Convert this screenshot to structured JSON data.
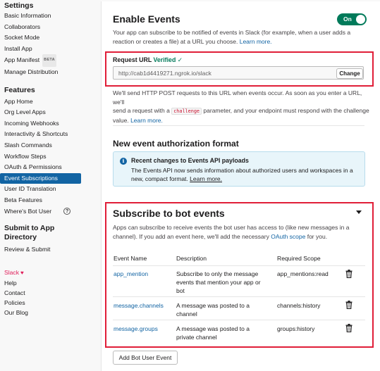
{
  "sidebar": {
    "settings_heading": "Settings",
    "settings_items": [
      "Basic Information",
      "Collaborators",
      "Socket Mode",
      "Install App"
    ],
    "app_manifest": "App Manifest",
    "beta_badge": "BETA",
    "manage_distribution": "Manage Distribution",
    "features_heading": "Features",
    "feature_items": [
      "App Home",
      "Org Level Apps",
      "Incoming Webhooks",
      "Interactivity & Shortcuts",
      "Slash Commands",
      "Workflow Steps",
      "OAuth & Permissions"
    ],
    "active_item": "Event Subscriptions",
    "feature_items_after": [
      "User ID Translation",
      "Beta Features"
    ],
    "wheres_bot_user": "Where's Bot User",
    "help_glyph": "?",
    "submit_heading_1": "Submit to App",
    "submit_heading_2": "Directory",
    "review_submit": "Review & Submit",
    "footer_slack": "Slack",
    "footer_links": [
      "Help",
      "Contact",
      "Policies",
      "Our Blog"
    ]
  },
  "enable_events": {
    "title": "Enable Events",
    "toggle_label": "On",
    "desc_line1": "Your app can subscribe to be notified of events in Slack (for example, when a user adds a",
    "desc_line2": "reaction or creates a file) at a URL you choose.",
    "learn_more": "Learn more.",
    "request_url_label": "Request URL",
    "verified": "Verified",
    "check": "✓",
    "url_value": "http://cab1d4419271.ngrok.io/slack",
    "change_button": "Change",
    "post_line1": "We'll send HTTP POST requests to this URL when events occur. As soon as you enter a URL, we'll",
    "post_line2a": "send a request with a",
    "challenge_code": "challenge",
    "post_line2b": "parameter, and your endpoint must respond with the challenge",
    "post_line3": "value.",
    "post_learn_more": "Learn more."
  },
  "auth_format": {
    "title": "New event authorization format",
    "info_title": "Recent changes to Events API payloads",
    "info_line1": "The Events API now sends information about authorized users and workspaces in a",
    "info_line2": "new, compact format.",
    "info_learn_more": "Learn more."
  },
  "bot_events": {
    "title": "Subscribe to bot events",
    "desc_line1": "Apps can subscribe to receive events the bot user has access to (like new messages in a",
    "desc_line2a": "channel). If you add an event here, we'll add the necessary",
    "oauth_scope": "OAuth scope",
    "desc_line2b": "for you.",
    "columns": [
      "Event Name",
      "Description",
      "Required Scope"
    ],
    "rows": [
      {
        "name": "app_mention",
        "desc": [
          "Subscribe to only the message",
          "events that mention your app or",
          "bot"
        ],
        "scope": "app_mentions:read"
      },
      {
        "name": "message.channels",
        "desc": [
          "A message was posted to a",
          "channel"
        ],
        "scope": "channels:history"
      },
      {
        "name": "message.groups",
        "desc": [
          "A message was posted to a",
          "private channel"
        ],
        "scope": "groups:history"
      }
    ],
    "add_button": "Add Bot User Event"
  },
  "colors": {
    "accent": "#1264a3",
    "toggle_on": "#007a5a",
    "highlight_box": "#e01e38",
    "active_nav": "#1264a3"
  }
}
